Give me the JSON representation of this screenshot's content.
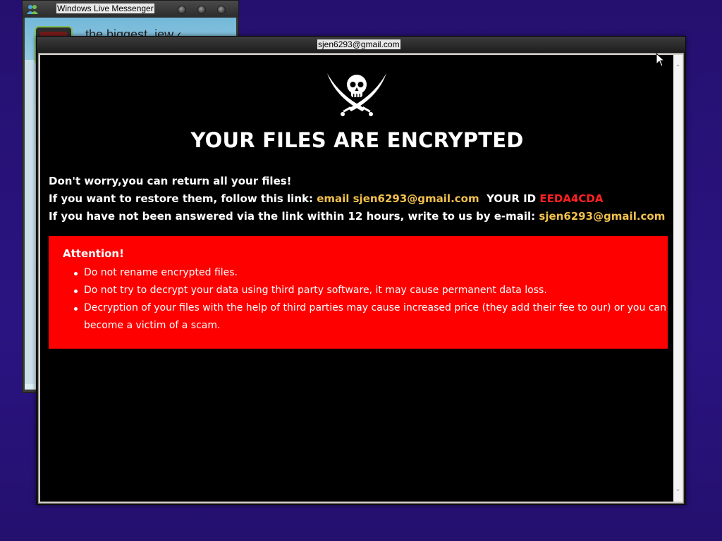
{
  "messenger": {
    "title": "Windows Live Messenger",
    "contact_name": "the biggest_jew ‹"
  },
  "ransom_window": {
    "title": "sjen6293@gmail.com",
    "headline": "YOUR FILES ARE ENCRYPTED",
    "line1": "Don't worry,you can return all your files!",
    "line2_prefix": "If you want to restore them, follow this link: ",
    "line2_email": "email sjen6293@gmail.com",
    "line2_id_label": "YOUR ID",
    "line2_id_value": "EEDA4CDA",
    "line3_prefix": "If you have not been answered via the link within 12 hours, write to us by e-mail: ",
    "line3_email": "sjen6293@gmail.com",
    "attention_title": "Attention!",
    "attention_items": [
      "Do not rename encrypted files.",
      "Do not try to decrypt your data using third party software, it may cause permanent data loss.",
      "Decryption of your files with the help of third parties may cause increased price (they add their fee to our) or you can become a victim of a scam."
    ]
  },
  "colors": {
    "desktop": "#27107a",
    "highlight_email": "#f2c14e",
    "id_red": "#ff2020",
    "attention_bg": "#ff0000"
  },
  "icons": [
    "messenger-app-icon",
    "pirate-skull-crossed-swords-icon",
    "scroll-up-arrow-icon",
    "scroll-down-arrow-icon",
    "mouse-cursor-icon"
  ]
}
